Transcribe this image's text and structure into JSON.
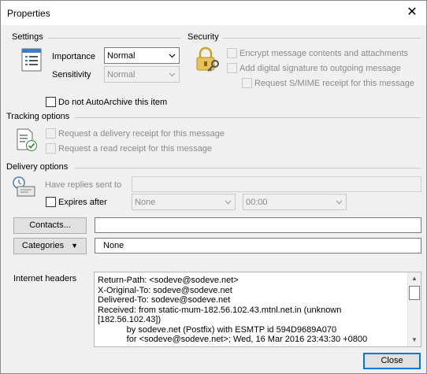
{
  "window": {
    "title": "Properties"
  },
  "settings": {
    "heading": "Settings",
    "importance_label": "Importance",
    "importance_value": "Normal",
    "sensitivity_label": "Sensitivity",
    "sensitivity_value": "Normal",
    "autoarchive_label": "Do not AutoArchive this item",
    "autoarchive_checked": false
  },
  "security": {
    "heading": "Security",
    "encrypt_label": "Encrypt message contents and attachments",
    "signature_label": "Add digital signature to outgoing message",
    "smime_label": "Request S/MIME receipt for this message"
  },
  "tracking": {
    "heading": "Tracking options",
    "delivery_receipt_label": "Request a delivery receipt for this message",
    "read_receipt_label": "Request a read receipt for this message"
  },
  "delivery": {
    "heading": "Delivery options",
    "replies_label": "Have replies sent to",
    "replies_value": "",
    "expires_label": "Expires after",
    "expires_date": "None",
    "expires_time": "00:00"
  },
  "contacts": {
    "button_label": "Contacts...",
    "value": ""
  },
  "categories": {
    "button_label": "Categories",
    "value": "None"
  },
  "internet_headers": {
    "label": "Internet headers",
    "lines": [
      "Return-Path: <sodeve@sodeve.net>",
      "X-Original-To: sodeve@sodeve.net",
      "Delivered-To: sodeve@sodeve.net",
      "Received: from static-mum-182.56.102.43.mtnl.net.in (unknown",
      "[182.56.102.43])",
      "            by sodeve.net (Postfix) with ESMTP id 594D9689A070",
      "            for <sodeve@sodeve.net>; Wed, 16 Mar 2016 23:43:30 +0800"
    ]
  },
  "footer": {
    "close_label": "Close"
  }
}
